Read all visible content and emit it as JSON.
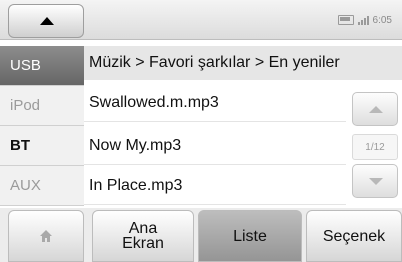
{
  "status": {
    "time": "6:05",
    "battery_icon": "battery-icon",
    "signal_icon": "signal-icon"
  },
  "sources": [
    {
      "label": "USB",
      "state": "active"
    },
    {
      "label": "iPod",
      "state": "dim"
    },
    {
      "label": "BT",
      "state": "normal"
    },
    {
      "label": "AUX",
      "state": "dim"
    }
  ],
  "breadcrumb": "Müzik > Favori şarkılar > En yeniler",
  "tracks": [
    "Swallowed.m.mp3",
    "Now My.mp3",
    "In Place.mp3"
  ],
  "pager": {
    "current_page": "1/12"
  },
  "bottom_tabs": {
    "home_icon": "home-icon",
    "main_screen_line1": "Ana",
    "main_screen_line2": "Ekran",
    "list": "Liste",
    "options": "Seçenek",
    "selected": "Liste"
  }
}
